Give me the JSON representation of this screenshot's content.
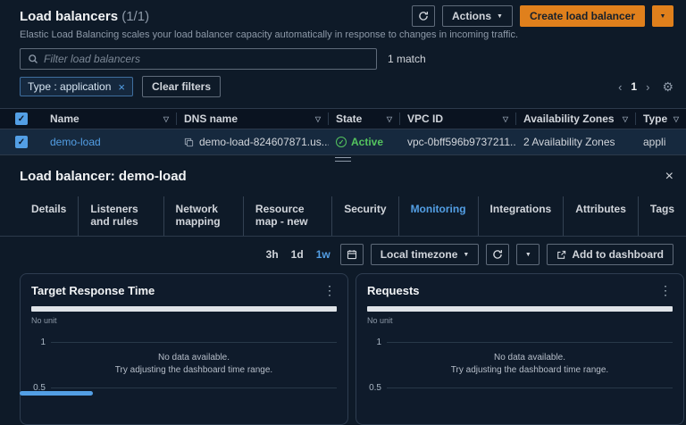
{
  "header": {
    "title": "Load balancers",
    "count": "(1/1)",
    "description": "Elastic Load Balancing scales your load balancer capacity automatically in response to changes in incoming traffic.",
    "actions_label": "Actions",
    "create_label": "Create load balancer"
  },
  "filters": {
    "search_placeholder": "Filter load balancers",
    "match_count": "1 match",
    "chip_label": "Type : application",
    "clear_label": "Clear filters",
    "page_number": "1"
  },
  "table": {
    "columns": [
      "Name",
      "DNS name",
      "State",
      "VPC ID",
      "Availability Zones",
      "Type"
    ],
    "row": {
      "name": "demo-load",
      "dns_name": "demo-load-824607871.us...",
      "state": "Active",
      "vpc_id": "vpc-0bff596b9737211...",
      "availability_zones": "2 Availability Zones",
      "type": "appli"
    }
  },
  "panel": {
    "title": "Load balancer: demo-load",
    "tabs": [
      "Details",
      "Listeners and rules",
      "Network mapping",
      "Resource map - new",
      "Security",
      "Monitoring",
      "Integrations",
      "Attributes",
      "Tags"
    ],
    "active_tab": "Monitoring",
    "toolbar": {
      "range_3h": "3h",
      "range_1d": "1d",
      "range_1w": "1w",
      "active_range": "1w",
      "timezone_label": "Local timezone",
      "add_to_dashboard_label": "Add to dashboard"
    },
    "charts": [
      {
        "title": "Target Response Time",
        "unit_label": "No unit",
        "ytick_1": "1",
        "ytick_05": "0.5",
        "empty_title": "No data available.",
        "empty_hint": "Try adjusting the dashboard time range."
      },
      {
        "title": "Requests",
        "unit_label": "No unit",
        "ytick_1": "1",
        "ytick_05": "0.5",
        "empty_title": "No data available.",
        "empty_hint": "Try adjusting the dashboard time range."
      }
    ]
  },
  "icons": {
    "check": "✓",
    "caret_down": "▼",
    "column_filter": "▽",
    "close": "×",
    "remove_filter": "×",
    "gear": "⚙",
    "page_prev": "‹",
    "page_next": "›",
    "overflow_menu": "⋮"
  },
  "colors": {
    "accent_blue": "#539fe5",
    "accent_orange": "#e0801c",
    "success_green": "#54c45e",
    "background": "#0e1a28"
  }
}
